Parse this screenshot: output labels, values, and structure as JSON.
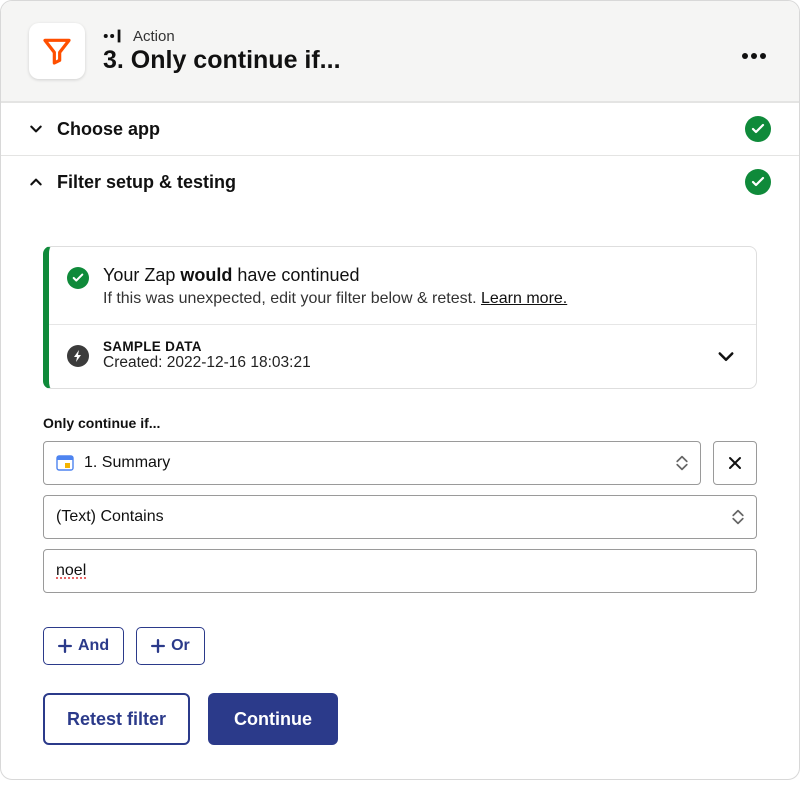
{
  "header": {
    "kicker": "Action",
    "title": "3. Only continue if..."
  },
  "sections": {
    "choose_app": {
      "label": "Choose app",
      "status": "complete"
    },
    "filter_setup": {
      "label": "Filter setup & testing",
      "status": "complete"
    }
  },
  "result": {
    "title_prefix": "Your Zap ",
    "title_bold": "would",
    "title_suffix": " have continued",
    "subtext": "If this was unexpected, edit your filter below & retest. ",
    "learn_more": "Learn more.",
    "sample_heading": "SAMPLE DATA",
    "sample_created_label": "Created: ",
    "sample_created_value": "2022-12-16 18:03:21"
  },
  "filter": {
    "heading": "Only continue if...",
    "rules": [
      {
        "field_label": "1. Summary",
        "operator_label": "(Text) Contains",
        "value": "noel"
      }
    ],
    "and_label": "And",
    "or_label": "Or"
  },
  "actions": {
    "retest": "Retest filter",
    "continue": "Continue"
  }
}
